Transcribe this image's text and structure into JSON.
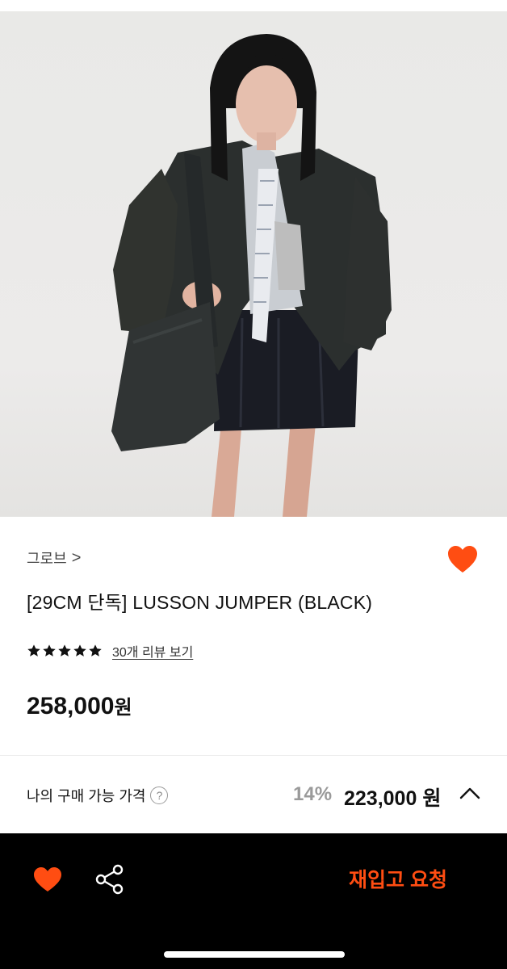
{
  "product": {
    "brand": "그로브",
    "brand_chevron": ">",
    "title": "[29CM 단독] LUSSON JUMPER (BLACK)",
    "rating_stars": 5,
    "review_link": "30개 리뷰 보기",
    "price_number": "258,000",
    "price_unit": "원"
  },
  "my_price": {
    "label": "나의 구매 가능 가격",
    "help": "?",
    "discount": "14%",
    "final_price": "223,000 원"
  },
  "bottom_bar": {
    "restock_label": "재입고 요청"
  },
  "icons": {
    "favorite": "heart-icon",
    "share": "share-icon",
    "expand": "chevron-up-icon",
    "help": "question-circle-icon"
  },
  "colors": {
    "accent": "#ff4d12",
    "bottom_bar": "#000000",
    "discount": "#9a9a9a"
  }
}
